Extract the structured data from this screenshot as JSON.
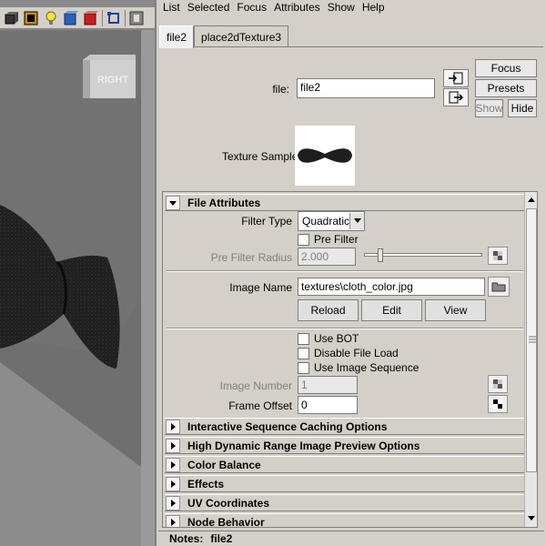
{
  "menu": [
    "List",
    "Selected",
    "Focus",
    "Attributes",
    "Show",
    "Help"
  ],
  "tabs": [
    "file2",
    "place2dTexture3"
  ],
  "node": {
    "file_label": "file:",
    "file_value": "file2",
    "focus_label": "Focus",
    "presets_label": "Presets",
    "show_label": "Show",
    "hide_label": "Hide",
    "texture_sample_label": "Texture Sample"
  },
  "viewport": {
    "viewcube_label": "RIGHT"
  },
  "file_attributes": {
    "header": "File Attributes",
    "filter_type_label": "Filter Type",
    "filter_type_value": "Quadratic",
    "pre_filter_label": "Pre Filter",
    "pre_filter_radius_label": "Pre Filter Radius",
    "pre_filter_radius_value": "2.000",
    "image_name_label": "Image Name",
    "image_name_value": "textures\\cloth_color.jpg",
    "reload_label": "Reload",
    "edit_label": "Edit",
    "view_label": "View",
    "use_bot_label": "Use BOT",
    "disable_file_load_label": "Disable File Load",
    "use_image_sequence_label": "Use Image Sequence",
    "image_number_label": "Image Number",
    "image_number_value": "1",
    "frame_offset_label": "Frame Offset",
    "frame_offset_value": "0"
  },
  "collapsed_sections": [
    "Interactive Sequence Caching Options",
    "High Dynamic Range Image Preview Options",
    "Color Balance",
    "Effects",
    "UV Coordinates",
    "Node Behavior"
  ],
  "notes": {
    "label": "Notes:",
    "value": "file2"
  },
  "colors": {
    "panel_bg": "#d4d0c8",
    "viewport_bg": "#8a8a8a",
    "bowtie": "#1e1e1e"
  }
}
